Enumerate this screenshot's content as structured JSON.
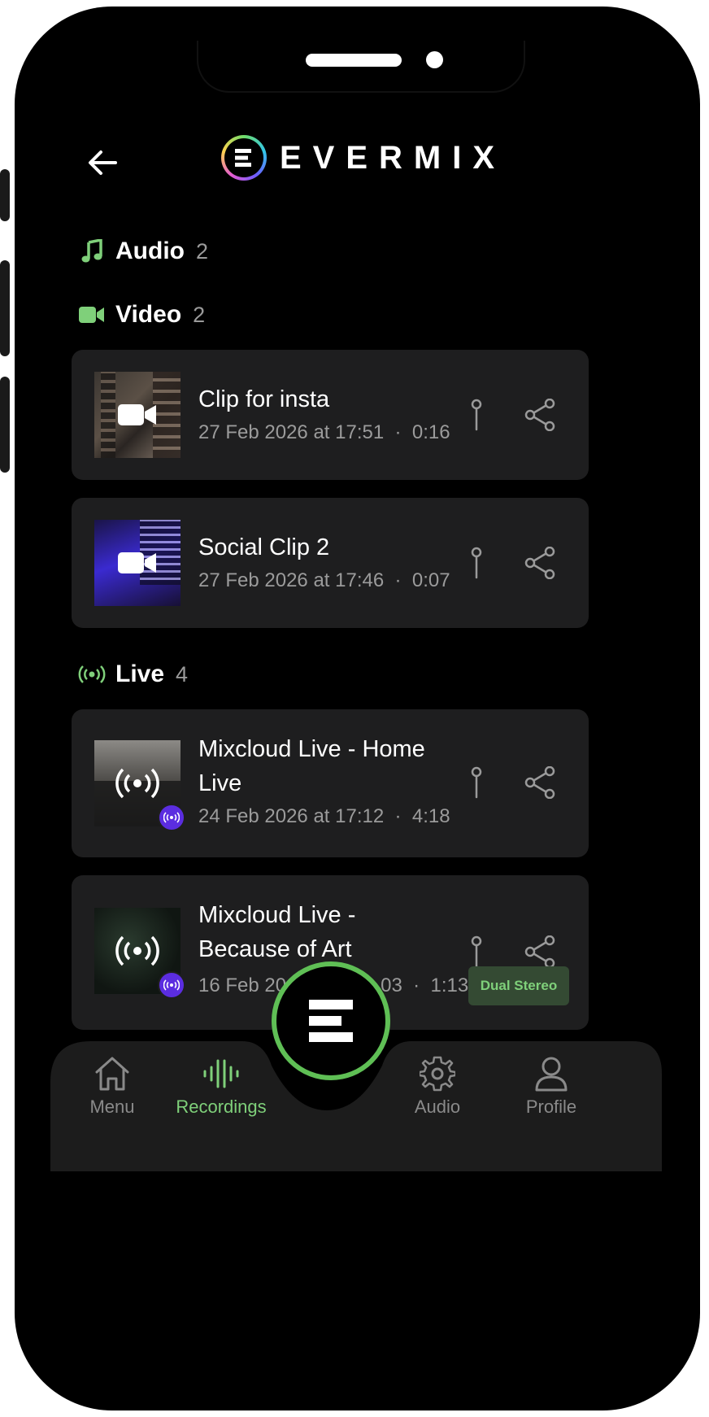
{
  "header": {
    "logo_text": "EVERMIX",
    "back_icon": "arrow-left-icon"
  },
  "sections": {
    "audio": {
      "title": "Audio",
      "count": "2",
      "icon": "music-note-icon"
    },
    "video": {
      "title": "Video",
      "count": "2",
      "icon": "video-camera-icon"
    },
    "live": {
      "title": "Live",
      "count": "4",
      "icon": "broadcast-icon"
    }
  },
  "recordings": [
    {
      "title": "Clip for insta",
      "date": "27 Feb 2026 at 17:51",
      "duration": "0:16",
      "kind": "video"
    },
    {
      "title": "Social Clip 2",
      "date": "27 Feb 2026 at 17:46",
      "duration": "0:07",
      "kind": "video"
    },
    {
      "title": "Mixcloud Live - Home Live",
      "date": "24 Feb 2026 at 17:12",
      "duration": "4:18",
      "kind": "live"
    },
    {
      "title": "Mixcloud Live - Because of Art",
      "date": "16 Feb 20",
      "date_tail": "03",
      "duration": "1:13",
      "kind": "live"
    }
  ],
  "dot_separator": "·",
  "status_badge": "Dual Stereo",
  "nav": {
    "menu": "Menu",
    "recordings": "Recordings",
    "audio": "Audio",
    "profile": "Profile"
  },
  "colors": {
    "accent_green": "#7fd07a",
    "live_purple": "#5b2de0",
    "card": "#1e1e1f"
  }
}
